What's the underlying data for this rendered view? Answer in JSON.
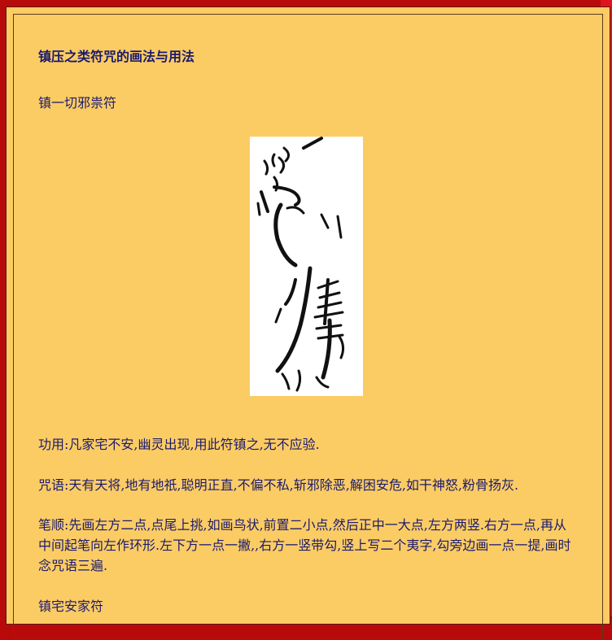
{
  "document": {
    "title": "镇压之类符咒的画法与用法",
    "talismans": [
      {
        "name": "镇一切邪祟符",
        "effect": "功用:凡家宅不安,幽灵出现,用此符镇之,无不应验.",
        "incantation": "咒语:天有天将,地有地祇,聪明正直,不偏不私,斩邪除恶,解困安危,如干神怒,粉骨扬灰.",
        "strokes": "笔顺:先画左方二点,点尾上挑,如画鸟状,前置二小点,然后正中一大点,左方两竖.右方一点,再从中间起笔向左作环形.左下方一点一撇,,右方一竖带勾,竖上写二个夷字,勾旁边画一点一提,画时念咒语三遍."
      },
      {
        "name": "镇宅安家符"
      }
    ]
  }
}
